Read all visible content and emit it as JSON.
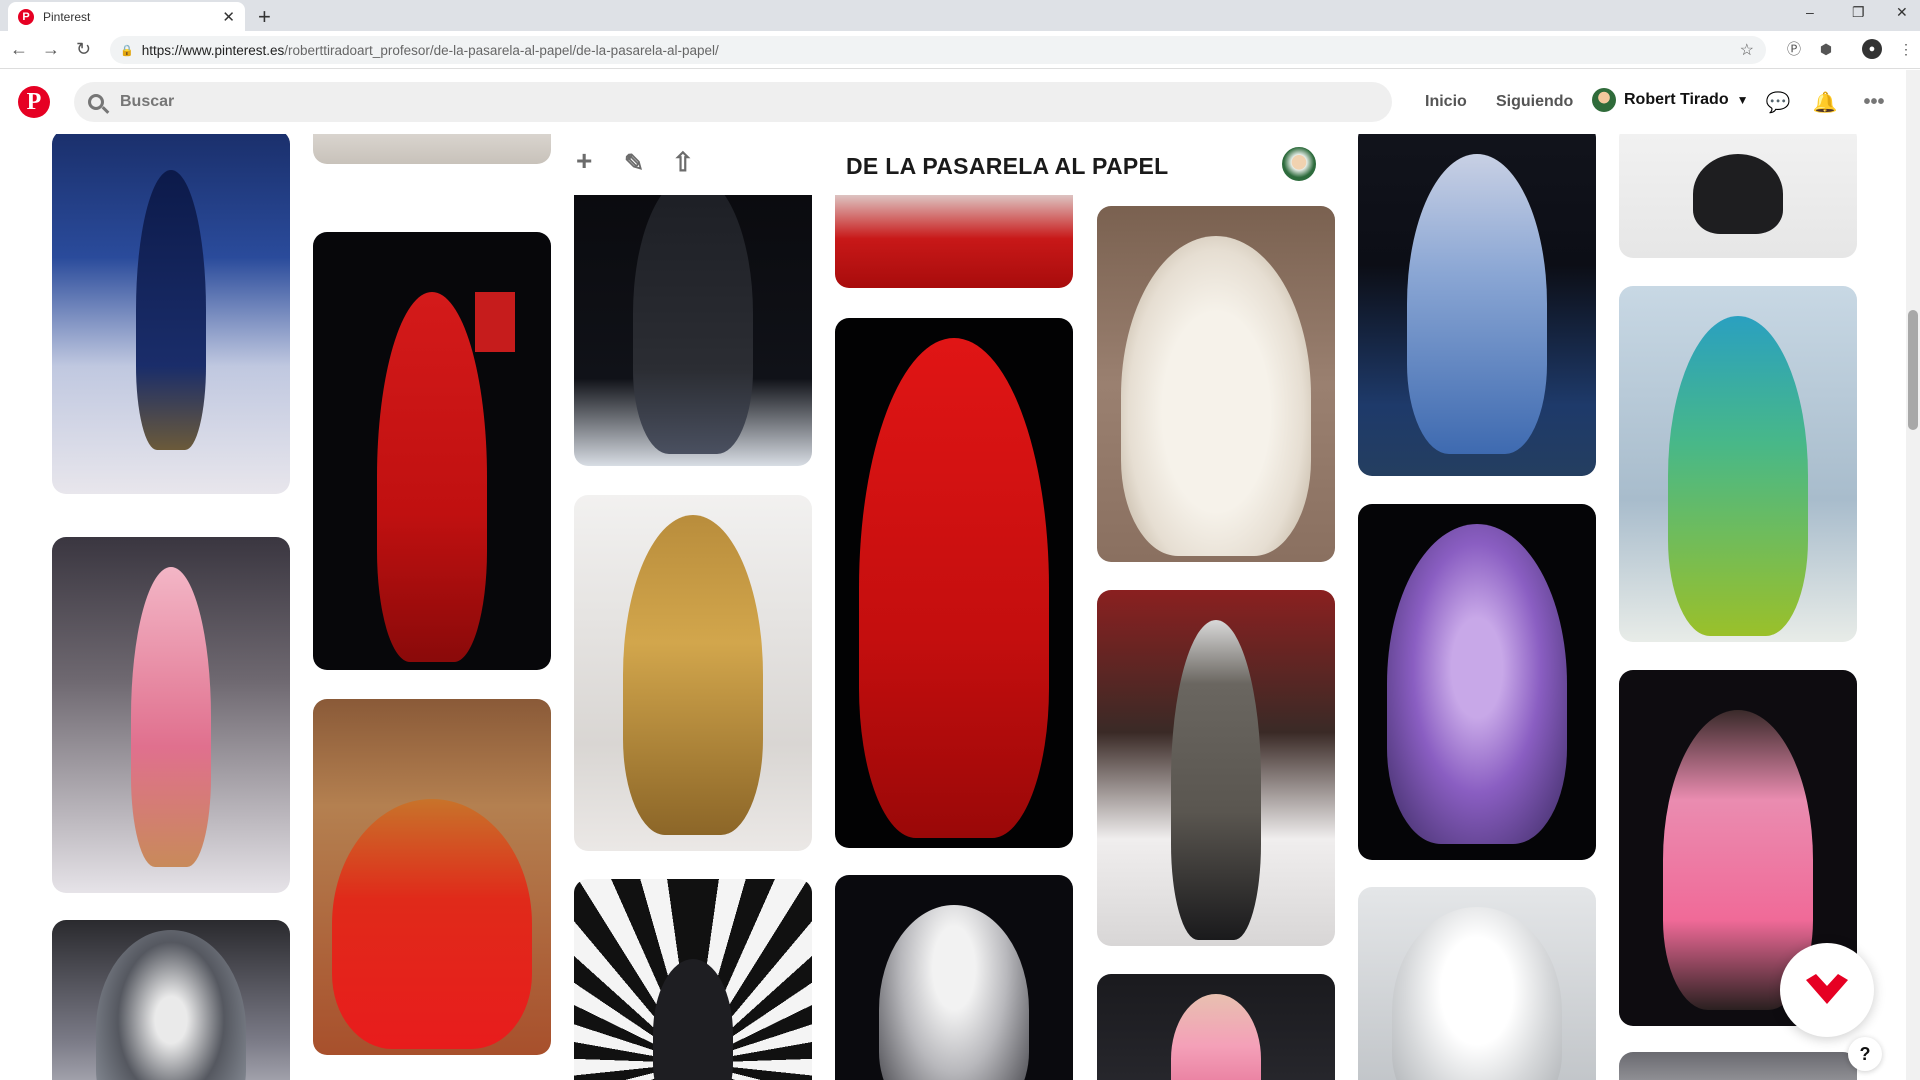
{
  "browser": {
    "tab_title": "Pinterest",
    "tab_close": "✕",
    "new_tab": "+",
    "url_host": "https://www.pinterest.es",
    "url_path": "/roberttiradoart_profesor/de-la-pasarela-al-papel/de-la-pasarela-al-papel/",
    "window_min": "–",
    "window_max": "❐",
    "window_close": "✕"
  },
  "header": {
    "logo": "P",
    "search_placeholder": "Buscar",
    "nav_home": "Inicio",
    "nav_following": "Siguiendo",
    "user_name": "Robert Tirado"
  },
  "board": {
    "title": "DE LA PASARELA AL PAPEL",
    "add_icon": "+",
    "edit_icon": "✎",
    "share_icon": "⇧"
  },
  "help_label": "?",
  "colors": {
    "pinterest_red": "#e60023",
    "page_bg": "#ffffff",
    "text_dark": "#111111",
    "text_muted": "#767676"
  },
  "pins": [
    {
      "id": "col1-a",
      "desc": "blue embroidered gown on runway"
    },
    {
      "id": "col1-b",
      "desc": "pink floral outfit on runway"
    },
    {
      "id": "col1-c",
      "desc": "silver hooded gown"
    },
    {
      "id": "col2-a",
      "desc": "runway image (top cropped)"
    },
    {
      "id": "col2-b",
      "desc": "red sequined gown with horned headpiece"
    },
    {
      "id": "col2-c",
      "desc": "red gown with gold winged sleeves"
    },
    {
      "id": "col3-a",
      "desc": "black sheer gown with cape"
    },
    {
      "id": "col3-b",
      "desc": "gold draped gown"
    },
    {
      "id": "col3-c",
      "desc": "black and white radial backdrop portrait"
    },
    {
      "id": "col4-a",
      "desc": "red gown (top cropped)"
    },
    {
      "id": "col4-b",
      "desc": "red latex outfit"
    },
    {
      "id": "col4-c",
      "desc": "white sculptural headpiece look"
    },
    {
      "id": "col5-a",
      "desc": "white dragon gown"
    },
    {
      "id": "col5-b",
      "desc": "houndstooth coat menswear"
    },
    {
      "id": "col5-c",
      "desc": "pink floral dress"
    },
    {
      "id": "col6-a",
      "desc": "blue ruffled gown"
    },
    {
      "id": "col6-b",
      "desc": "purple ruffled costume"
    },
    {
      "id": "col6-c",
      "desc": "white dragon sculptural piece"
    },
    {
      "id": "col7-a",
      "desc": "black boot (top cropped)"
    },
    {
      "id": "col7-b",
      "desc": "green and blue mermaid gown"
    },
    {
      "id": "col7-c",
      "desc": "pink feathered dress"
    },
    {
      "id": "col7-d",
      "desc": "cropped image"
    }
  ]
}
